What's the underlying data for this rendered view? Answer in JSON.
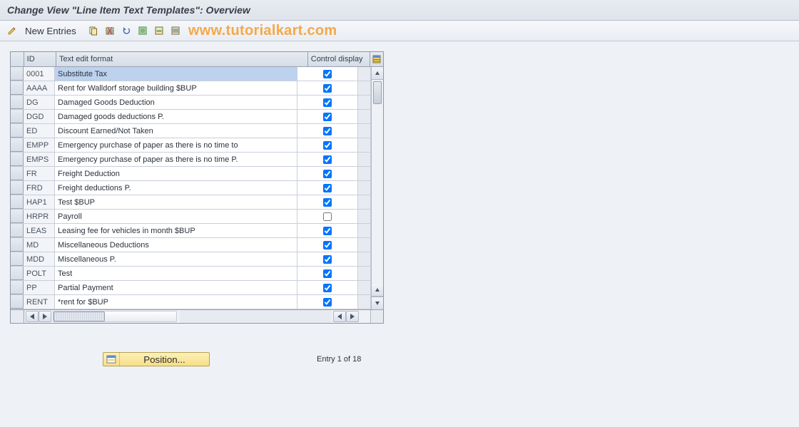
{
  "title": "Change View \"Line Item Text Templates\": Overview",
  "toolbar": {
    "new_entries": "New Entries"
  },
  "brand": "www.tutorialkart.com",
  "grid": {
    "columns": {
      "sel": "",
      "id": "ID",
      "text": "Text edit format",
      "ctrl": "Control display"
    },
    "rows": [
      {
        "id": "0001",
        "text": "Substitute Tax",
        "ctrl": true,
        "selected": true
      },
      {
        "id": "AAAA",
        "text": "Rent for Walldorf storage building $BUP",
        "ctrl": true
      },
      {
        "id": "DG",
        "text": "Damaged Goods Deduction",
        "ctrl": true
      },
      {
        "id": "DGD",
        "text": "Damaged goods deductions P.",
        "ctrl": true
      },
      {
        "id": "ED",
        "text": "Discount Earned/Not Taken",
        "ctrl": true
      },
      {
        "id": "EMPP",
        "text": "Emergency purchase of paper as there is no time to",
        "ctrl": true
      },
      {
        "id": "EMPS",
        "text": "Emergency purchase of paper as there is no time P.",
        "ctrl": true
      },
      {
        "id": "FR",
        "text": "Freight Deduction",
        "ctrl": true
      },
      {
        "id": "FRD",
        "text": "Freight deductions P.",
        "ctrl": true
      },
      {
        "id": "HAP1",
        "text": "Test $BUP",
        "ctrl": true
      },
      {
        "id": "HRPR",
        "text": "Payroll",
        "ctrl": false
      },
      {
        "id": "LEAS",
        "text": "Leasing fee for vehicles in month $BUP",
        "ctrl": true
      },
      {
        "id": "MD",
        "text": "Miscellaneous Deductions",
        "ctrl": true
      },
      {
        "id": "MDD",
        "text": "Miscellaneous P.",
        "ctrl": true
      },
      {
        "id": "POLT",
        "text": "Test",
        "ctrl": true
      },
      {
        "id": "PP",
        "text": "Partial Payment",
        "ctrl": true
      },
      {
        "id": "RENT",
        "text": "*rent for $BUP",
        "ctrl": true
      }
    ]
  },
  "footer": {
    "position_label": "Position...",
    "entry_text": "Entry 1 of 18"
  }
}
